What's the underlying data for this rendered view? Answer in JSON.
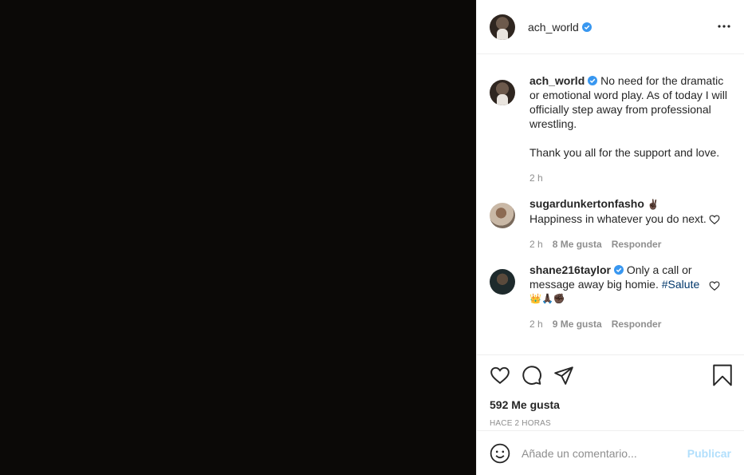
{
  "colors": {
    "media_bg": "#0b0907",
    "accent": "#0095f6",
    "verified": "#3897f0",
    "muted": "#8e8e8e",
    "post_disabled": "#b2dffc"
  },
  "header": {
    "username": "ach_world",
    "verified": true,
    "more_icon": "more-horizontal-icon"
  },
  "caption": {
    "username": "ach_world",
    "text_line1": "No need for the dramatic or emotional word play. As of today I will officially step away from professional wrestling.",
    "text_line2": "Thank you all for the support and love.",
    "time": "2 h"
  },
  "comments": [
    {
      "username": "sugardunkertonfasho",
      "emoji_after_name": "✌🏿",
      "text": "Happiness in whatever you do next.",
      "time": "2 h",
      "likes": "8 Me gusta",
      "reply": "Responder"
    },
    {
      "username": "shane216taylor",
      "verified": true,
      "text": "Only a call or message away big homie.",
      "hashtag": "#Salute",
      "emojis": "👑🙏🏿✊🏿",
      "time": "2 h",
      "likes": "9 Me gusta",
      "reply": "Responder"
    }
  ],
  "actions": {
    "likes": "592 Me gusta",
    "timestamp": "HACE 2 HORAS"
  },
  "add_comment": {
    "placeholder": "Añade un comentario...",
    "post_label": "Publicar"
  }
}
